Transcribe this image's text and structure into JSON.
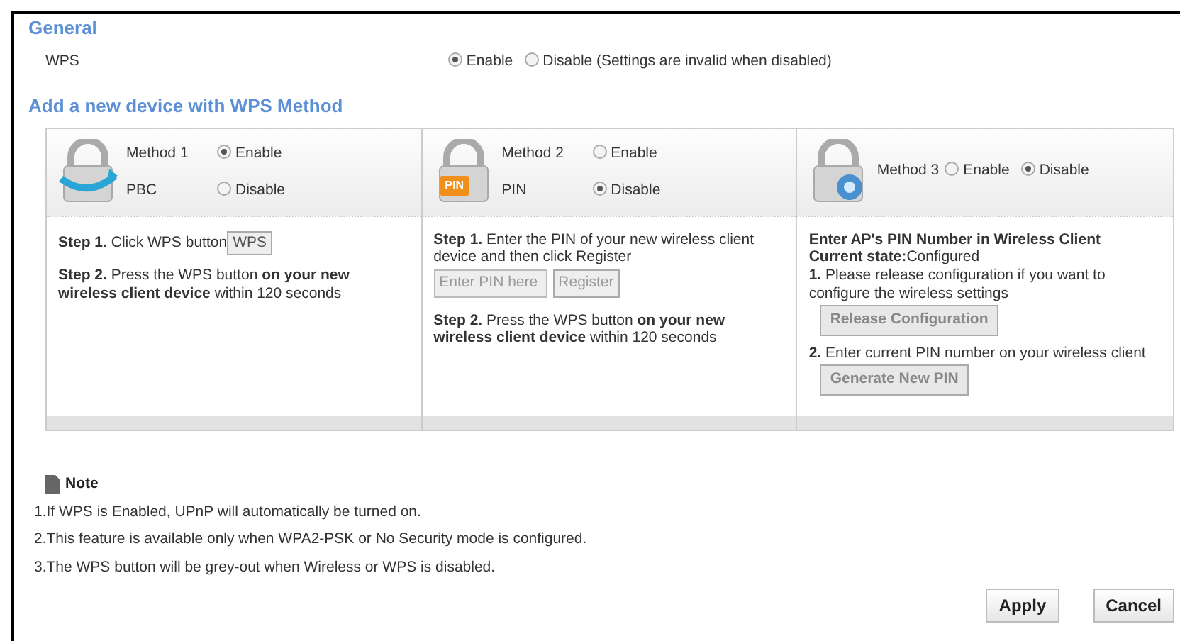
{
  "general": {
    "heading": "General",
    "wps": {
      "label": "WPS",
      "options": [
        {
          "label": "Enable",
          "selected": true
        },
        {
          "label": "Disable (Settings are invalid when disabled)",
          "selected": false
        }
      ]
    }
  },
  "methods_heading": "Add a new device with WPS Method",
  "methods": [
    {
      "kind": "pbc",
      "title": "Method 1",
      "sublabel": "PBC",
      "options": [
        {
          "label": "Enable",
          "selected": true
        },
        {
          "label": "Disable",
          "selected": false
        }
      ],
      "blocks": [
        {
          "kind": "paragraph",
          "text": "**Step 1.** Click WPS button",
          "button": "WPS"
        },
        {
          "kind": "paragraph",
          "text": "**Step 2.** Press the WPS button **on your new wireless client device** within 120 seconds"
        }
      ]
    },
    {
      "kind": "pin",
      "badge": "PIN",
      "title": "Method 2",
      "sublabel": "PIN",
      "options": [
        {
          "label": "Enable",
          "selected": false
        },
        {
          "label": "Disable",
          "selected": true
        }
      ],
      "blocks": [
        {
          "kind": "line",
          "text": "**Step 1.** Enter the PIN of your new wireless client device and then click Register"
        },
        {
          "kind": "pin_entry",
          "placeholder": "Enter PIN here",
          "button": "Register"
        },
        {
          "kind": "paragraph",
          "text": "**Step 2.** Press the WPS button **on your new wireless client device** within 120 seconds"
        }
      ]
    },
    {
      "kind": "ap_pin",
      "title": "Method 3",
      "options": [
        {
          "label": "Enable",
          "selected": false
        },
        {
          "label": "Disable",
          "selected": true
        }
      ],
      "blocks": [
        {
          "kind": "line",
          "text": "**Enter AP's PIN Number in Wireless Client**"
        },
        {
          "kind": "line",
          "text": "**Current state:**Configured"
        },
        {
          "kind": "line",
          "text": "**1.** Please release configuration if you want to configure the wireless settings"
        },
        {
          "kind": "button",
          "label": "Release Configuration"
        },
        {
          "kind": "line",
          "text": "**2.** Enter current PIN number  on your wireless client"
        },
        {
          "kind": "button",
          "label": "Generate New PIN"
        }
      ]
    }
  ],
  "note": {
    "title": "Note",
    "items": [
      "1.If WPS is Enabled, UPnP will automatically be turned on.",
      "2.This feature is available only when WPA2-PSK or No Security mode is configured.",
      "3.The WPS button will be grey-out when Wireless or WPS is disabled."
    ]
  },
  "buttons": [
    "Apply",
    "Cancel"
  ]
}
